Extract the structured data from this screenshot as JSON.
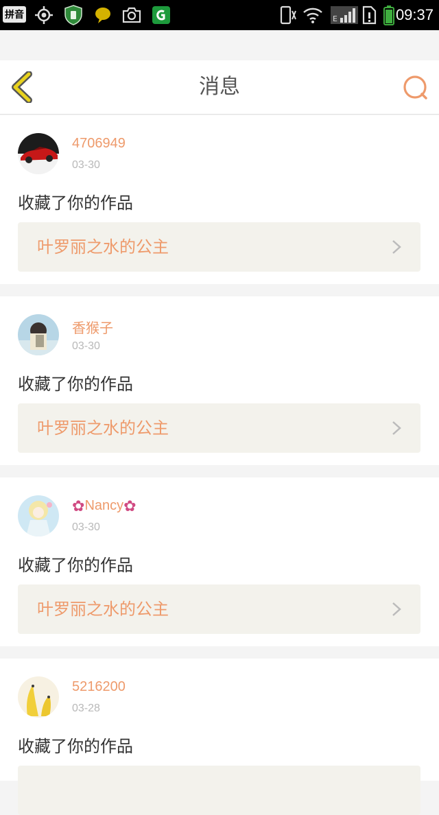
{
  "status_bar": {
    "ime_label": "拼音",
    "time": "09:37"
  },
  "header": {
    "title": "消息"
  },
  "icons": {
    "back": "back-chevron-icon",
    "search": "search-icon",
    "chevron": "chevron-right-icon"
  },
  "colors": {
    "accent": "#ee9a6b",
    "back_icon_yellow": "#e8d21e",
    "card_link_bg": "#f3f2ec"
  },
  "messages": [
    {
      "username": "4706949",
      "date": "03-30",
      "action": "收藏了你的作品",
      "work_title": "叶罗丽之水的公主"
    },
    {
      "username": "香猴子",
      "date": "03-30",
      "action": "收藏了你的作品",
      "work_title": "叶罗丽之水的公主"
    },
    {
      "username": "Nancy",
      "username_decoration": "✿",
      "date": "03-30",
      "action": "收藏了你的作品",
      "work_title": "叶罗丽之水的公主"
    },
    {
      "username": "5216200",
      "date": "03-28",
      "action": "收藏了你的作品",
      "work_title": ""
    }
  ]
}
